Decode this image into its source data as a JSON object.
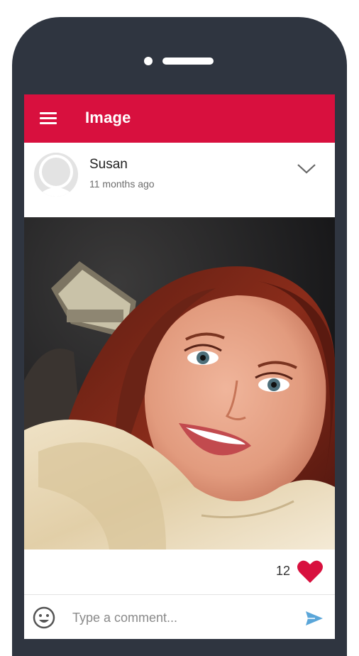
{
  "app_bar": {
    "title": "Image",
    "color": "#d8103e",
    "menu_icon": "hamburger-menu-icon"
  },
  "post": {
    "author": "Susan",
    "time": "11 months ago",
    "options_icon": "chevron-down-icon",
    "photo": "selfie-photo",
    "like_count": "12",
    "like_icon": "heart-icon",
    "like_color": "#d8103e"
  },
  "comment": {
    "placeholder": "Type a comment...",
    "emoji_icon": "emoji-icon",
    "send_icon": "send-icon",
    "send_color": "#5aa6d9"
  }
}
